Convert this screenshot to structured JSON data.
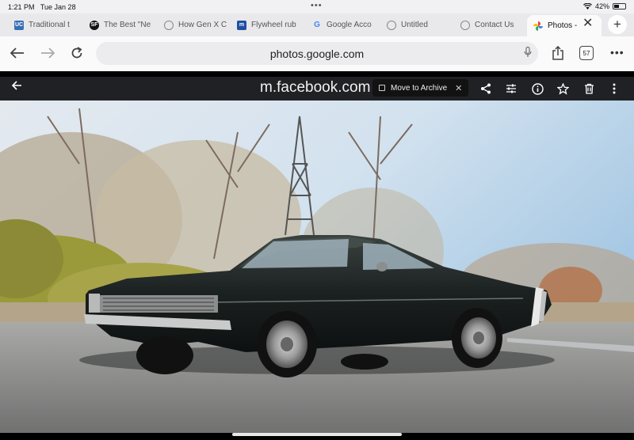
{
  "status_bar": {
    "time": "1:21 PM",
    "date": "Tue Jan 28",
    "battery": "42%"
  },
  "tabs": [
    {
      "label": "Traditional t",
      "favicon_color": "#3a6fb5",
      "favicon_text": "UC"
    },
    {
      "label": "The Best \"Ne",
      "favicon_color": "#111111",
      "favicon_text": "SF"
    },
    {
      "label": "How Gen X C",
      "favicon_color": "#9aa0a6",
      "favicon_text": ""
    },
    {
      "label": "Flywheel rub",
      "favicon_color": "#1f4fa3",
      "favicon_text": "m"
    },
    {
      "label": "Google Acco",
      "favicon_color": "#ffffff",
      "favicon_text": "G"
    },
    {
      "label": "Untitled",
      "favicon_color": "#9aa0a6",
      "favicon_text": ""
    },
    {
      "label": "Contact Us",
      "favicon_color": "#9aa0a6",
      "favicon_text": ""
    },
    {
      "label": "Photos -",
      "favicon_color": "#fbbc05",
      "favicon_text": "",
      "active": true
    }
  ],
  "toolbar": {
    "url": "photos.google.com",
    "tab_count": "57"
  },
  "viewer": {
    "title": "m.facebook.com",
    "archive_label": "Move to Archive"
  },
  "colors": {
    "viewer_bg": "#202124",
    "toolbar_bg": "#fafafa",
    "tabs_bg": "#e9e9ec"
  }
}
